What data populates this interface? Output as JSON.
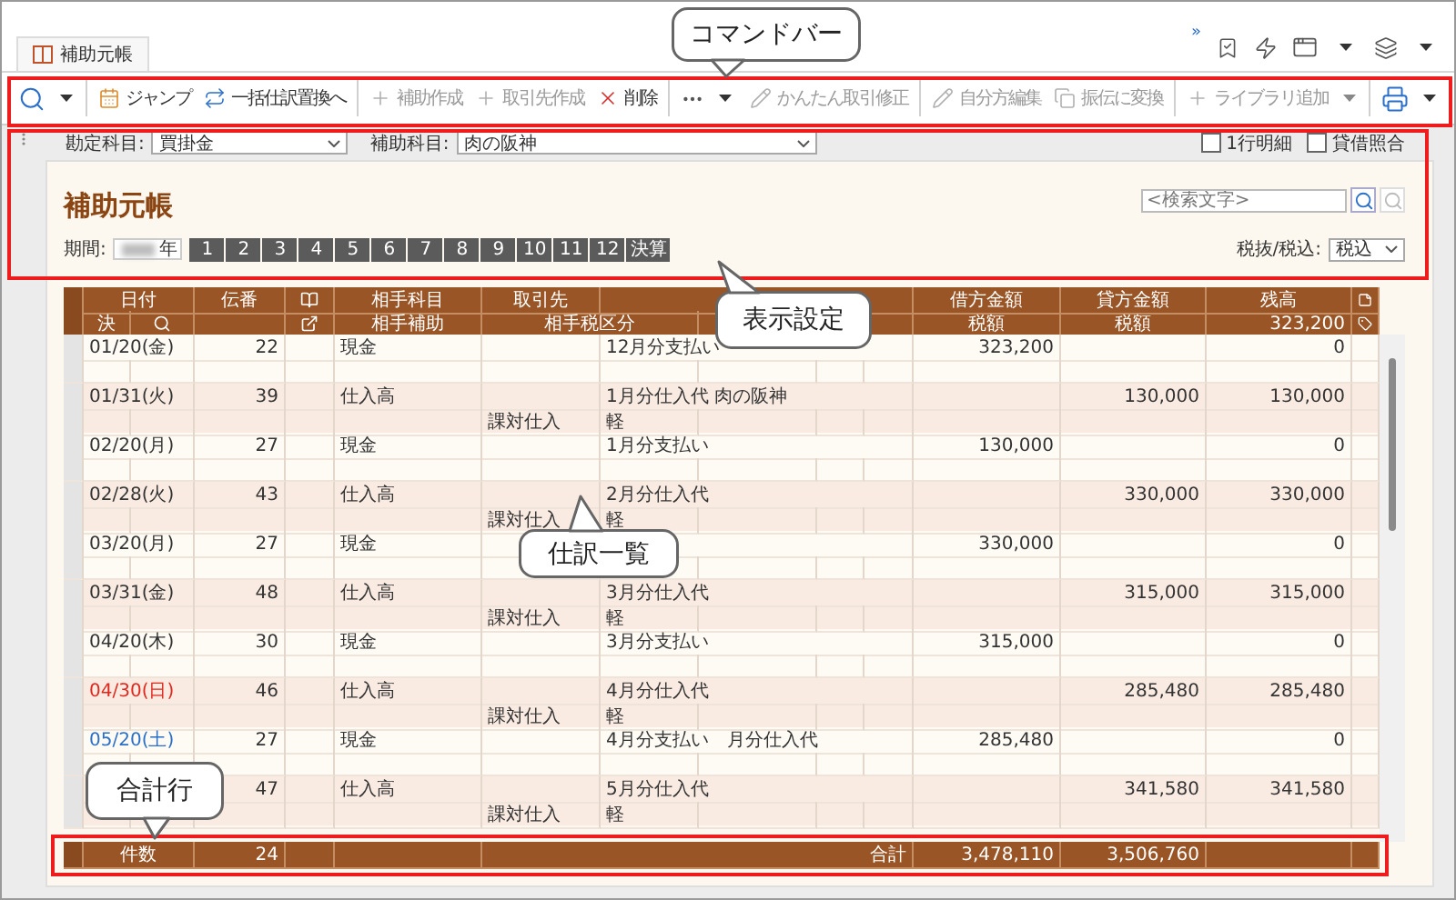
{
  "tab": {
    "title": "補助元帳",
    "selected": true
  },
  "top_right": {
    "overflow": "»"
  },
  "command_bar": {
    "buttons": [
      {
        "label": "ジャンプ",
        "disabled": false
      },
      {
        "label": "一括仕訳置換へ",
        "disabled": false
      },
      {
        "label": "補助作成",
        "disabled": true
      },
      {
        "label": "取引先作成",
        "disabled": true
      },
      {
        "label": "削除",
        "disabled": false
      },
      {
        "label": "かんたん取引修正",
        "disabled": true
      },
      {
        "label": "自分方編集",
        "disabled": true
      },
      {
        "label": "振伝に変換",
        "disabled": true
      },
      {
        "label": "ライブラリ追加",
        "disabled": true
      }
    ]
  },
  "filters": {
    "account": {
      "label": "勘定科目:",
      "value": "買掛金"
    },
    "sub_account": {
      "label": "補助科目:",
      "value": "肉の阪神"
    },
    "checkboxes": [
      {
        "label": "1行明細",
        "checked": false
      },
      {
        "label": "貸借照合",
        "checked": false
      }
    ]
  },
  "ledger": {
    "title": "補助元帳",
    "search": {
      "placeholder": "<検索文字>"
    },
    "period": {
      "label": "期間:",
      "year_suffix": "年",
      "months": [
        {
          "label": "1",
          "selected": false
        },
        {
          "label": "2",
          "selected": false
        },
        {
          "label": "3",
          "selected": false
        },
        {
          "label": "4",
          "selected": false
        },
        {
          "label": "5",
          "selected": false
        },
        {
          "label": "6",
          "selected": false
        },
        {
          "label": "7",
          "selected": false
        },
        {
          "label": "8",
          "selected": false
        },
        {
          "label": "9",
          "selected": false
        },
        {
          "label": "10",
          "selected": false
        },
        {
          "label": "11",
          "selected": false
        },
        {
          "label": "12",
          "selected": false
        },
        {
          "label": "決算",
          "selected": false
        }
      ]
    },
    "tax_mode": {
      "label": "税抜/税込:",
      "value": "税込"
    }
  },
  "journal": {
    "header": {
      "date": "日付",
      "voucher": "伝番",
      "account": "相手科目",
      "partner": "取引先",
      "debit": "借方金額",
      "credit": "貸方金額",
      "balance": "残高",
      "settled": "決",
      "sub_account": "相手補助",
      "tax_class": "相手税区分",
      "debit_tax": "税額",
      "credit_tax": "税額",
      "opening_balance": "323,200"
    },
    "rows": [
      {
        "date": "01/20(金)",
        "color": "#333333",
        "voucher": "22",
        "account": "現金",
        "description": "12月分支払い",
        "debit": "323,200",
        "balance": "0"
      },
      {
        "date": "01/31(火)",
        "color": "#333333",
        "voucher": "39",
        "account": "仕入高",
        "description": "1月分仕入代 肉の阪神",
        "credit": "130,000",
        "balance": "130,000",
        "tax_class": "課対仕入",
        "tax_mark": "軽"
      },
      {
        "date": "02/20(月)",
        "color": "#333333",
        "voucher": "27",
        "account": "現金",
        "description": "1月分支払い",
        "debit": "130,000",
        "balance": "0"
      },
      {
        "date": "02/28(火)",
        "color": "#333333",
        "voucher": "43",
        "account": "仕入高",
        "description": "2月分仕入代",
        "credit": "330,000",
        "balance": "330,000",
        "tax_class": "課対仕入",
        "tax_mark": "軽"
      },
      {
        "date": "03/20(月)",
        "color": "#333333",
        "voucher": "27",
        "account": "現金",
        "debit": "330,000",
        "balance": "0"
      },
      {
        "date": "03/31(金)",
        "color": "#333333",
        "voucher": "48",
        "account": "仕入高",
        "description": "3月分仕入代",
        "credit": "315,000",
        "balance": "315,000",
        "tax_class": "課対仕入",
        "tax_mark": "軽"
      },
      {
        "date": "04/20(木)",
        "color": "#333333",
        "voucher": "30",
        "account": "現金",
        "description": "3月分支払い",
        "debit": "315,000",
        "balance": "0"
      },
      {
        "date": "04/30(日)",
        "color": "#e0281e",
        "voucher": "46",
        "account": "仕入高",
        "description": "4月分仕入代",
        "credit": "285,480",
        "balance": "285,480",
        "tax_class": "課対仕入",
        "tax_mark": "軽"
      },
      {
        "date": "05/20(土)",
        "color": "#2a6fc9",
        "voucher": "27",
        "account": "現金",
        "description": "4月分支払い　月分仕入代",
        "debit": "285,480",
        "balance": "0"
      },
      {
        "voucher": "47",
        "account": "仕入高",
        "description": "5月分仕入代",
        "credit": "341,580",
        "balance": "341,580",
        "tax_class": "課対仕入",
        "tax_mark": "軽"
      }
    ],
    "footer": {
      "count_label": "件数",
      "count": "24",
      "total_label": "合計",
      "debit_total": "3,478,110",
      "credit_total": "3,506,760"
    }
  },
  "callouts": [
    {
      "text": "コマンドバー"
    },
    {
      "text": "表示設定"
    },
    {
      "text": "仕訳一覧"
    },
    {
      "text": "合計行"
    }
  ]
}
